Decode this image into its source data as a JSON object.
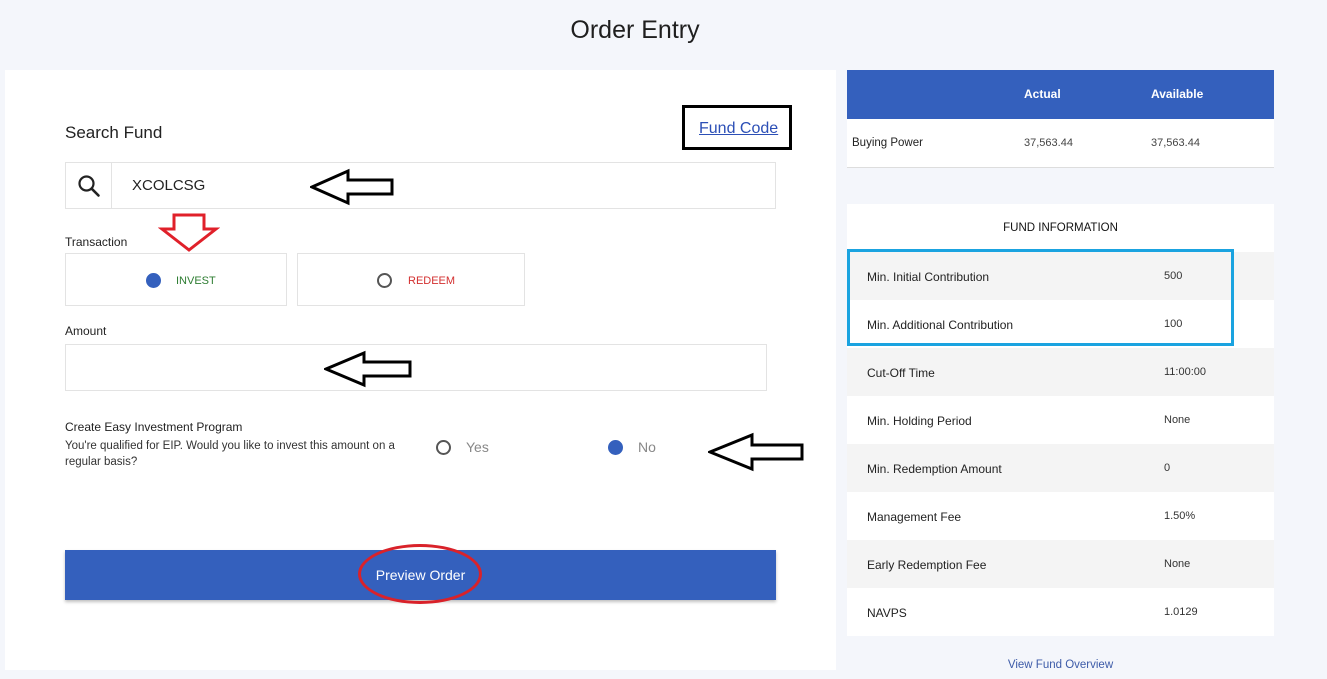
{
  "page": {
    "title": "Order Entry"
  },
  "search": {
    "title": "Search Fund",
    "fund_code_link": "Fund Code",
    "value": "XCOLCSG"
  },
  "transaction": {
    "label": "Transaction",
    "options": [
      {
        "label": "INVEST",
        "selected": true,
        "color": "#2e7d32"
      },
      {
        "label": "REDEEM",
        "selected": false,
        "color": "#d32f2f"
      }
    ]
  },
  "amount": {
    "label": "Amount",
    "value": ""
  },
  "eip": {
    "title": "Create Easy Investment Program",
    "description": "You're qualified for EIP. Would you like to invest this amount on a regular basis?",
    "options": [
      {
        "label": "Yes",
        "selected": false
      },
      {
        "label": "No",
        "selected": true
      }
    ]
  },
  "preview_button": "Preview Order",
  "buying_power": {
    "headers": [
      "",
      "Actual",
      "Available"
    ],
    "row": {
      "label": "Buying Power",
      "actual": "37,563.44",
      "available": "37,563.44"
    }
  },
  "fund_info": {
    "title": "FUND INFORMATION",
    "rows": [
      {
        "label": "Min. Initial Contribution",
        "value": "500"
      },
      {
        "label": "Min. Additional Contribution",
        "value": "100"
      },
      {
        "label": "Cut-Off Time",
        "value": "11:00:00"
      },
      {
        "label": "Min. Holding Period",
        "value": "None"
      },
      {
        "label": "Min. Redemption Amount",
        "value": "0"
      },
      {
        "label": "Management Fee",
        "value": "1.50%"
      },
      {
        "label": "Early Redemption Fee",
        "value": "None"
      },
      {
        "label": "NAVPS",
        "value": "1.0129"
      }
    ]
  },
  "view_fund_overview": "View Fund Overview",
  "colors": {
    "primary": "#3460bd",
    "annotation_red": "#d9222a",
    "annotation_blue": "#1aa3e0"
  }
}
